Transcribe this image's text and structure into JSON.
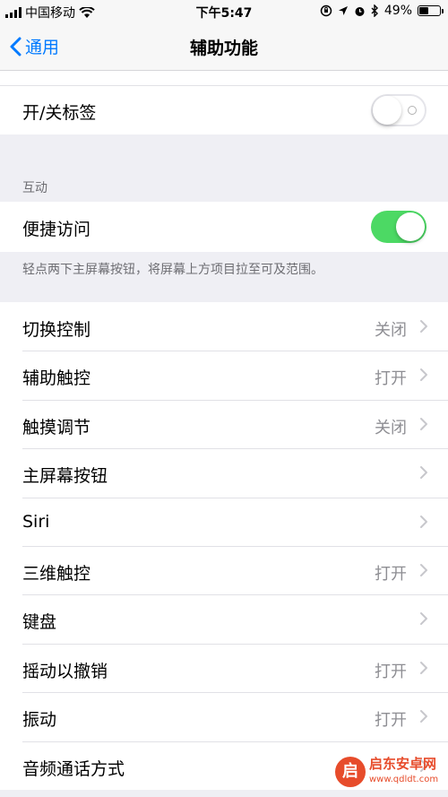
{
  "status_bar": {
    "carrier": "中国移动",
    "time": "下午5:47",
    "battery": "49%",
    "battery_level": 0.49
  },
  "nav": {
    "back_label": "通用",
    "title": "辅助功能"
  },
  "rows_top": {
    "labels_toggle": {
      "label": "开/关标签",
      "state": "off"
    }
  },
  "interaction": {
    "header": "互动",
    "reachability": {
      "label": "便捷访问",
      "state": "on"
    },
    "reachability_note": "轻点两下主屏幕按钮，将屏幕上方项目拉至可及范围。"
  },
  "list": [
    {
      "label": "切换控制",
      "value": "关闭"
    },
    {
      "label": "辅助触控",
      "value": "打开"
    },
    {
      "label": "触摸调节",
      "value": "关闭"
    },
    {
      "label": "主屏幕按钮",
      "value": ""
    },
    {
      "label": "Siri",
      "value": ""
    },
    {
      "label": "三维触控",
      "value": "打开"
    },
    {
      "label": "键盘",
      "value": ""
    },
    {
      "label": "摇动以撤销",
      "value": "打开"
    },
    {
      "label": "振动",
      "value": "打开"
    },
    {
      "label": "音频通话方式",
      "value": ""
    }
  ],
  "watermark": {
    "logo": "启",
    "name": "启东安卓网",
    "url": "www.qdldt.com"
  },
  "colors": {
    "accent": "#007aff",
    "toggle_on": "#4cd964"
  }
}
